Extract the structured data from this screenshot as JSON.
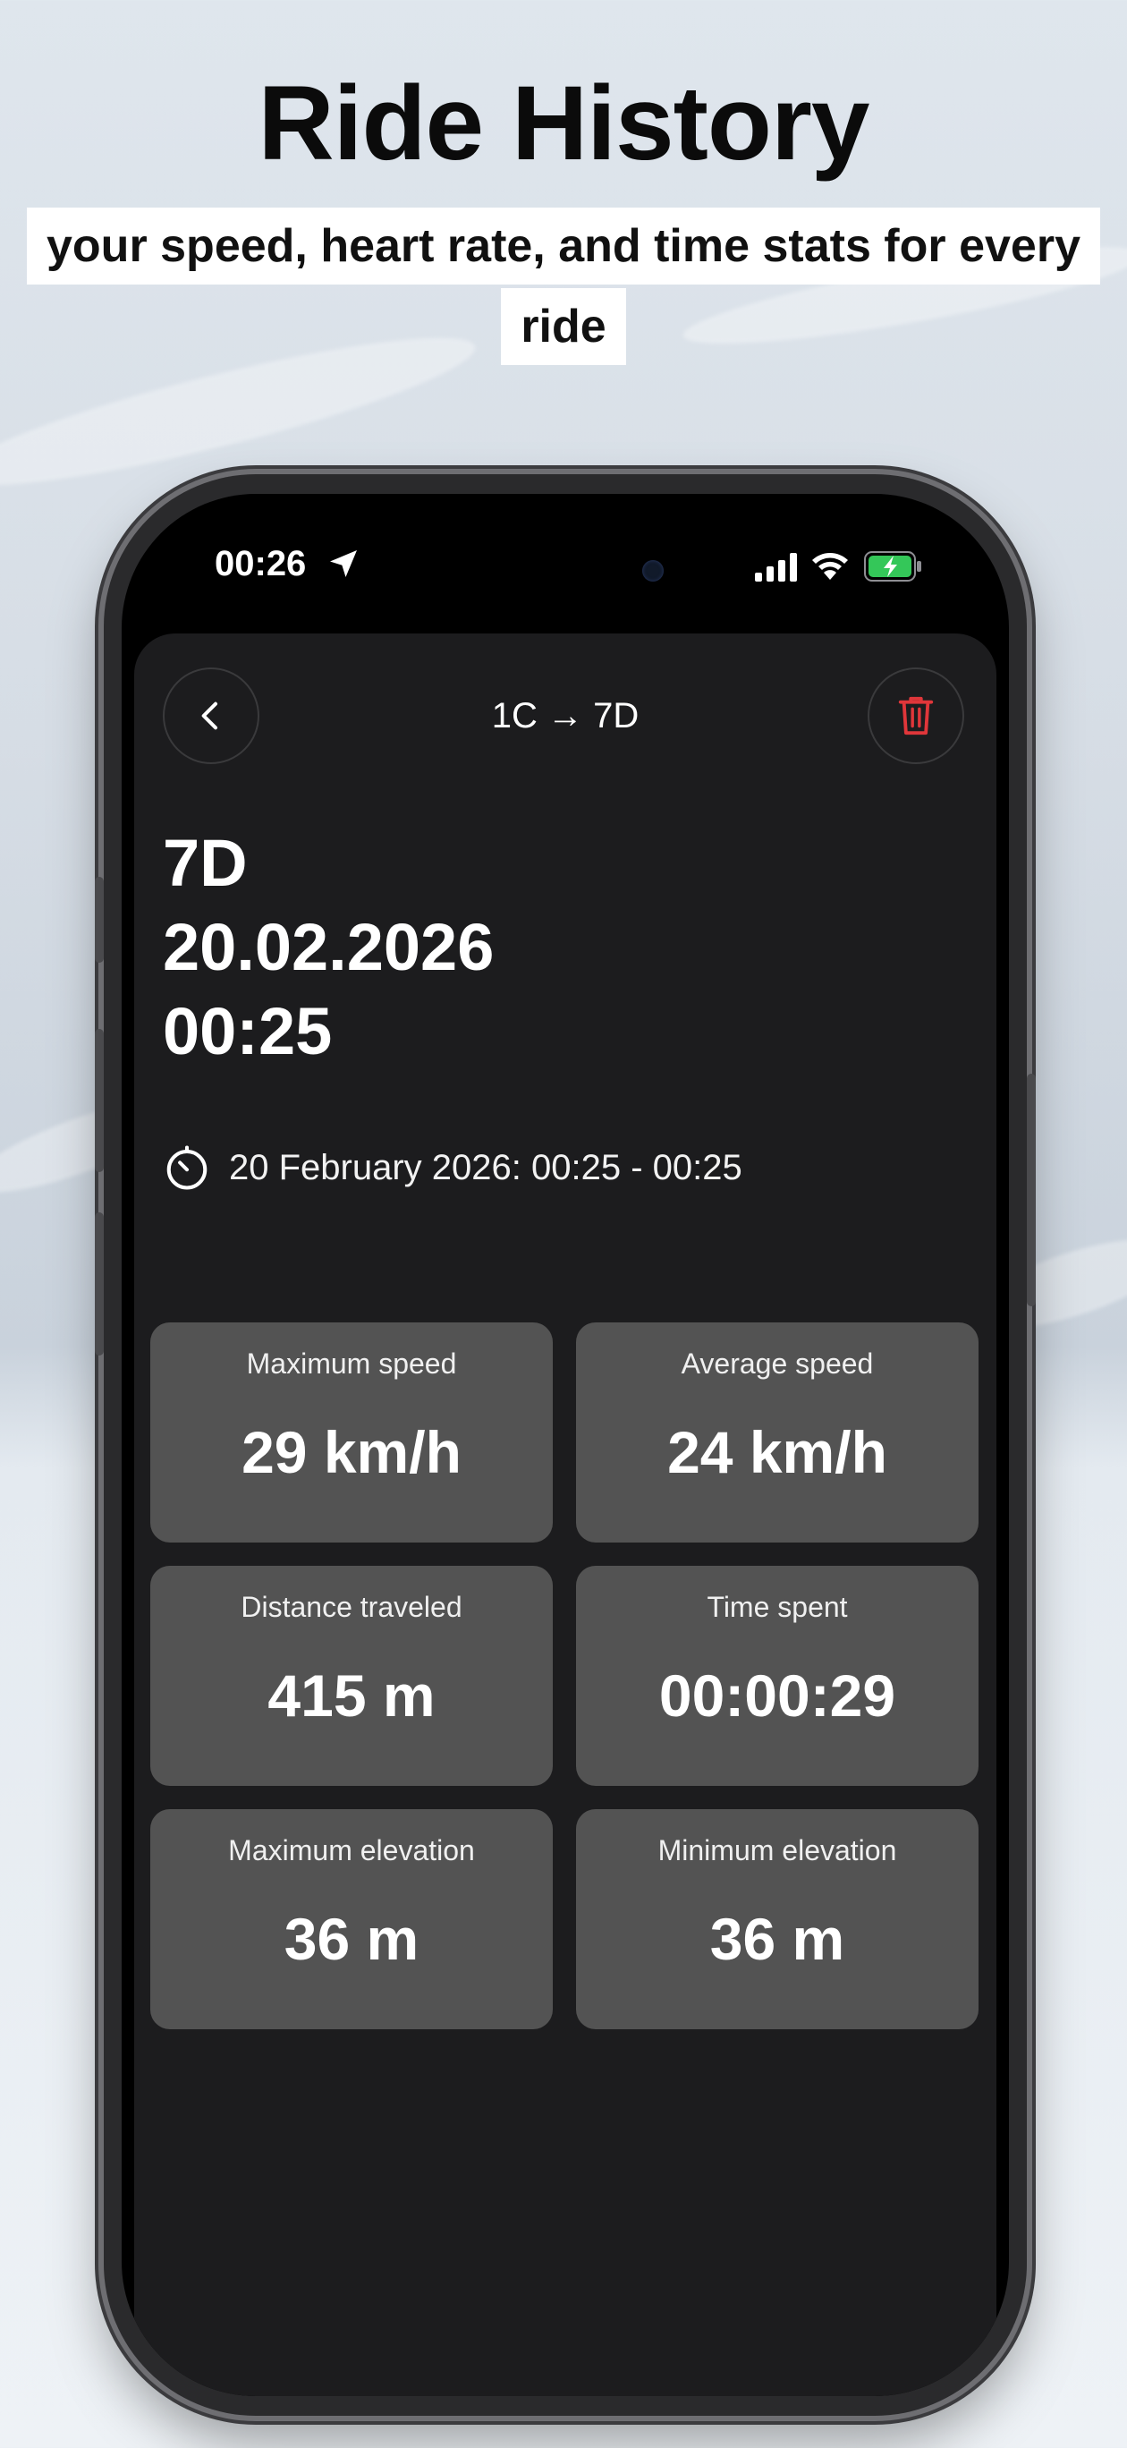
{
  "promo": {
    "title": "Ride History",
    "subtitle": "your speed, heart rate, and time stats for every ride"
  },
  "status_bar": {
    "time": "00:26",
    "location_icon": "location-arrow-icon",
    "signal_icon": "cellular-signal-icon",
    "wifi_icon": "wifi-icon",
    "battery_icon": "battery-charging-icon"
  },
  "nav": {
    "back_icon": "chevron-left-icon",
    "title": "1C → 7D",
    "delete_icon": "trash-icon"
  },
  "ride": {
    "name": "7D",
    "date": "20.02.2026",
    "time": "00:25",
    "range_icon": "timer-icon",
    "range_text": "20 February 2026: 00:25 - 00:25"
  },
  "stats": [
    {
      "label": "Maximum speed",
      "value": "29 km/h"
    },
    {
      "label": "Average speed",
      "value": "24 km/h"
    },
    {
      "label": "Distance traveled",
      "value": "415 m"
    },
    {
      "label": "Time spent",
      "value": "00:00:29"
    },
    {
      "label": "Maximum elevation",
      "value": "36 m"
    },
    {
      "label": "Minimum elevation",
      "value": "36 m"
    }
  ],
  "colors": {
    "sheet_bg": "#1c1c1e",
    "card_bg": "#535353",
    "delete_red": "#e0363a",
    "battery_green": "#34c759"
  }
}
